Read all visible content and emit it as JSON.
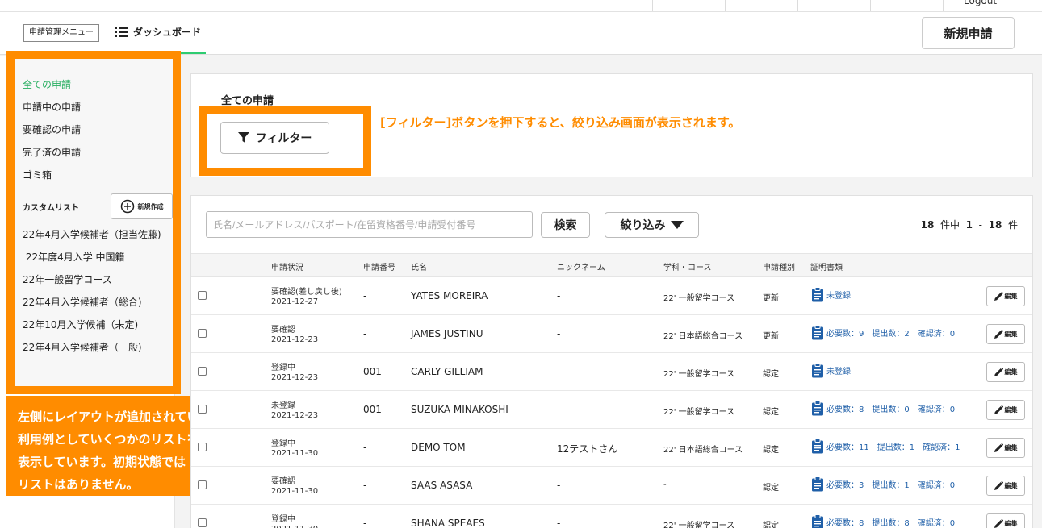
{
  "topbar": {
    "logout_label": "Logout"
  },
  "header": {
    "menu_chip": "申請管理メニュー",
    "dashboard_label": "ダッシュボード",
    "new_application_button": "新規申請"
  },
  "sidebar": {
    "items": [
      {
        "label": "全ての申請",
        "active": true
      },
      {
        "label": "申請中の申請",
        "active": false
      },
      {
        "label": "要確認の申請",
        "active": false
      },
      {
        "label": "完了済の申請",
        "active": false
      },
      {
        "label": "ゴミ箱",
        "active": false
      }
    ],
    "custom_list_label": "カスタムリスト",
    "create_button": "新規作成",
    "custom_lists": [
      "22年4月入学候補者（担当佐藤)",
      " 22年度4月入学 中国籍",
      "22年一般留学コース",
      "22年4月入学候補者（総合)",
      "22年10月入学候補（未定)",
      "22年4月入学候補者（一般)"
    ]
  },
  "annotations": {
    "left_note_lines": [
      "左側にレイアウトが追加されています。",
      "利用例としていくつかのリストを",
      "表示しています。初期状態では",
      "リストはありません。"
    ],
    "filter_note": "[フィルター]ボタンを押下すると、絞り込み画面が表示されます。"
  },
  "panel": {
    "title": "全ての申請",
    "filter_button": "フィルター"
  },
  "list": {
    "search_placeholder": "氏名/メールアドレス/パスポート/在留資格番号/申請受付番号",
    "search_button": "検索",
    "narrow_button": "絞り込み",
    "count": {
      "total": "18",
      "suffix1": "件中",
      "from": "1",
      "dash": "-",
      "to": "18",
      "suffix2": "件"
    },
    "columns": [
      "申請状況",
      "申請番号",
      "氏名",
      "ニックネーム",
      "学科・コース",
      "申請種別",
      "証明書類"
    ],
    "edit_label": "編集",
    "rows": [
      {
        "status": "要確認(差し戻し後)",
        "date": "2021-12-27",
        "number": "-",
        "name": "YATES MOREIRA",
        "nickname": "-",
        "course": "22' 一般留学コース",
        "type": "更新",
        "docs": "未登録"
      },
      {
        "status": "要確認",
        "date": "2021-12-23",
        "number": "-",
        "name": "JAMES JUSTINU",
        "nickname": "-",
        "course": "22' 日本語総合コース",
        "type": "更新",
        "docs": "必要数：9　提出数：2　確認済：0"
      },
      {
        "status": "登録中",
        "date": "2021-12-23",
        "number": "001",
        "name": "CARLY GILLIAM",
        "nickname": "-",
        "course": "22' 一般留学コース",
        "type": "認定",
        "docs": "未登録"
      },
      {
        "status": "未登録",
        "date": "2021-12-23",
        "number": "001",
        "name": "SUZUKA MINAKOSHI",
        "nickname": "-",
        "course": "22' 一般留学コース",
        "type": "認定",
        "docs": "必要数：8　提出数：0　確認済：0"
      },
      {
        "status": "登録中",
        "date": "2021-11-30",
        "number": "-",
        "name": "DEMO TOM",
        "nickname": "12テストさん",
        "course": "22' 日本語総合コース",
        "type": "認定",
        "docs": "必要数：11　提出数：1　確認済：1"
      },
      {
        "status": "要確認",
        "date": "2021-11-30",
        "number": "-",
        "name": "SAAS ASASA",
        "nickname": "-",
        "course": "-",
        "type": "認定",
        "docs": "必要数：3　提出数：1　確認済：0"
      },
      {
        "status": "登録中",
        "date": "2021-11-30",
        "number": "-",
        "name": "SHANA SPEAES",
        "nickname": "-",
        "course": "22' 一般留学コース",
        "type": "認定",
        "docs": "必要数：8　提出数：8　確認済：0"
      }
    ]
  },
  "colors": {
    "accent_orange": "#ff8c00",
    "active_green": "#27ae60",
    "link_blue": "#1f5fa8"
  },
  "icons": [
    "menu-icon",
    "plus-circle-icon",
    "funnel-icon",
    "caret-down-icon",
    "clipboard-icon",
    "pencil-icon"
  ]
}
